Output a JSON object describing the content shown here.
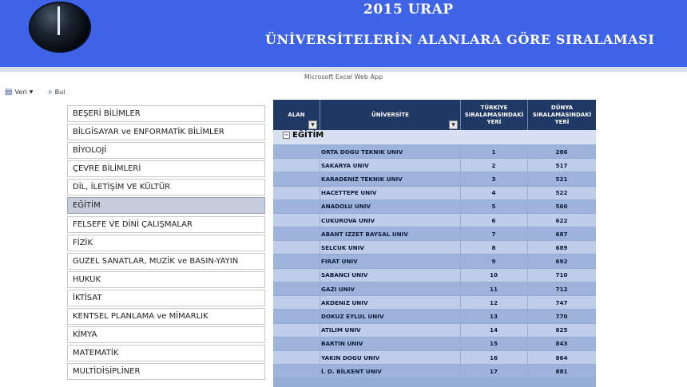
{
  "banner": {
    "title1": "2015 URAP",
    "title2": "ÜNİVERSİTELERİN ALANLARA GÖRE SIRALAMASI"
  },
  "app": {
    "name": "Microsoft Excel Web App"
  },
  "toolbar": {
    "data_label": "Veri",
    "find_label": "Bul"
  },
  "fields": [
    "BEŞERİ BİLİMLER",
    "BİLGİSAYAR ve ENFORMATİK BİLİMLER",
    "BİYOLOJİ",
    "ÇEVRE BİLİMLERİ",
    "DİL, İLETİŞİM VE KÜLTÜR",
    "EĞİTİM",
    "FELSEFE VE DİNİ ÇALIŞMALAR",
    "FİZİK",
    "GUZEL SANATLAR, MUZİK ve BASIN-YAYIN",
    "HUKUK",
    "İKTİSAT",
    "KENTSEL PLANLAMA ve MİMARLIK",
    "KİMYA",
    "MATEMATİK",
    "MULTİDİSİPLİNER"
  ],
  "selected_field_index": 5,
  "table": {
    "headers": {
      "alan": "ALAN",
      "universite": "ÜNİVERSİTE",
      "turkiye": "TÜRKİYE SIRALAMASINDAKİ YERİ",
      "dunya": "DÜNYA SIRALAMASINDAKİ YERİ"
    },
    "group": "EĞİTİM",
    "rows": [
      [
        "ORTA DOGU TEKNIK UNIV",
        "1",
        "286"
      ],
      [
        "SAKARYA UNIV",
        "2",
        "517"
      ],
      [
        "KARADENIZ TEKNIK UNIV",
        "3",
        "521"
      ],
      [
        "HACETTEPE UNIV",
        "4",
        "522"
      ],
      [
        "ANADOLU UNIV",
        "5",
        "560"
      ],
      [
        "CUKUROVA UNIV",
        "6",
        "622"
      ],
      [
        "ABANT IZZET BAYSAL UNIV",
        "7",
        "687"
      ],
      [
        "SELCUK UNIV",
        "8",
        "689"
      ],
      [
        "FIRAT UNIV",
        "9",
        "692"
      ],
      [
        "SABANCI UNIV",
        "10",
        "710"
      ],
      [
        "GAZI UNIV",
        "11",
        "712"
      ],
      [
        "AKDENIZ UNIV",
        "12",
        "747"
      ],
      [
        "DOKUZ EYLUL UNIV",
        "13",
        "770"
      ],
      [
        "ATILIM UNIV",
        "14",
        "825"
      ],
      [
        "BARTIN UNIV",
        "15",
        "843"
      ],
      [
        "YAKIN DOGU UNIV",
        "16",
        "864"
      ],
      [
        "İ. D. BİLKENT UNIV",
        "17",
        "881"
      ]
    ]
  },
  "colors": {
    "banner": "#3f63e6",
    "header": "#1f3864",
    "row_a": "#9db3db",
    "row_b": "#bfcdeb",
    "selected": "#c6cede"
  }
}
